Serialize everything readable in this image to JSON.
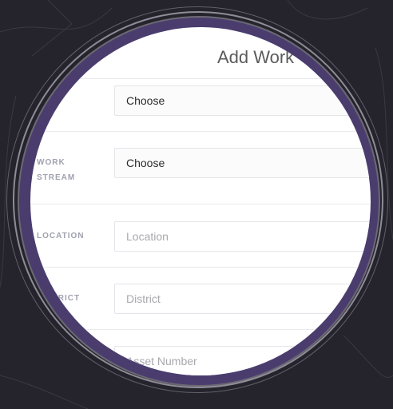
{
  "form": {
    "title": "Add Work",
    "rows": [
      {
        "label": "",
        "value": "Choose",
        "type": "select"
      },
      {
        "label": "WORK STREAM",
        "label_line1": "WORK",
        "label_line2": "STREAM",
        "value": "Choose",
        "type": "select"
      },
      {
        "label": "LOCATION",
        "placeholder": "Location",
        "type": "input"
      },
      {
        "label": "DISTRICT",
        "placeholder": "District",
        "type": "input"
      },
      {
        "label": "",
        "placeholder": "Asset Number",
        "type": "input"
      }
    ]
  },
  "colors": {
    "background": "#25242c",
    "ring": "#4a3d6e",
    "label": "#9fa1ae",
    "title": "#5b5b5b"
  }
}
